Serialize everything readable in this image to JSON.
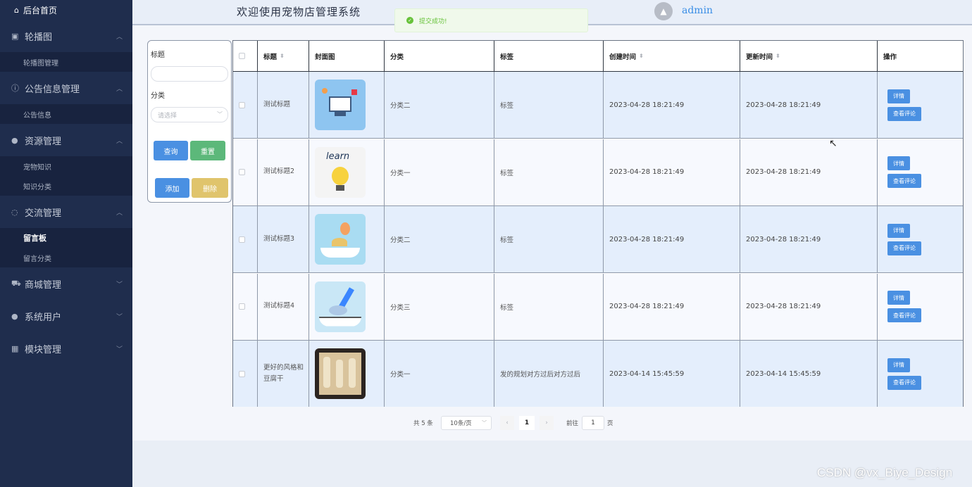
{
  "sidebar": {
    "home": "后台首页",
    "menus": [
      {
        "label": "轮播图",
        "icon": "image-icon",
        "subs": [
          "轮播图管理"
        ]
      },
      {
        "label": "公告信息管理",
        "icon": "info-icon",
        "subs": [
          "公告信息"
        ]
      },
      {
        "label": "资源管理",
        "icon": "bulb-icon",
        "subs": [
          "宠物知识",
          "知识分类"
        ]
      },
      {
        "label": "交流管理",
        "icon": "chat-icon",
        "subs": [
          "留言板",
          "留言分类"
        ]
      },
      {
        "label": "商城管理",
        "icon": "cart-icon",
        "subs": []
      },
      {
        "label": "系统用户",
        "icon": "user-icon",
        "subs": []
      },
      {
        "label": "模块管理",
        "icon": "grid-icon",
        "subs": []
      }
    ],
    "active_sub": "留言板"
  },
  "header": {
    "welcome": "欢迎使用宠物店管理系统",
    "username": "admin"
  },
  "toast": {
    "text": "提交成功!"
  },
  "filter": {
    "title_label": "标题",
    "title_value": "",
    "category_label": "分类",
    "category_placeholder": "请选择",
    "query_label": "查询",
    "reset_label": "重置",
    "add_label": "添加",
    "delete_label": "删除"
  },
  "table": {
    "headers": [
      "标题",
      "封面图",
      "分类",
      "标签",
      "创建时间",
      "更新时间",
      "操作"
    ],
    "rows": [
      {
        "title": "测试标题",
        "image": "computer-illustration",
        "category": "分类二",
        "tag": "标签",
        "created": "2023-04-28 18:21:49",
        "updated": "2023-04-28 18:21:49"
      },
      {
        "title": "测试标题2",
        "image": "learn-bulb-illustration",
        "category": "分类一",
        "tag": "标签",
        "created": "2023-04-28 18:21:49",
        "updated": "2023-04-28 18:21:49"
      },
      {
        "title": "测试标题3",
        "image": "book-balloon-illustration",
        "category": "分类二",
        "tag": "标签",
        "created": "2023-04-28 18:21:49",
        "updated": "2023-04-28 18:21:49"
      },
      {
        "title": "测试标题4",
        "image": "book-rocket-illustration",
        "category": "分类三",
        "tag": "标签",
        "created": "2023-04-28 18:21:49",
        "updated": "2023-04-28 18:21:49"
      },
      {
        "title": "更好的风格和豆腐干",
        "image": "gift-box-photo",
        "category": "分类一",
        "tag": "发的规划对方过后对方过后",
        "created": "2023-04-14 15:45:59",
        "updated": "2023-04-14 15:45:59"
      }
    ],
    "detail_label": "详情",
    "comment_label": "查看评论"
  },
  "pager": {
    "total": "共 5 条",
    "page_size": "10条/页",
    "current": "1",
    "goto_label": "前往",
    "goto_value": "1",
    "page_unit": "页"
  },
  "watermark": "CSDN @vx_Biye_Design",
  "colors": {
    "sidebar": "#1f2d4d",
    "primary": "#4a90e2",
    "success": "#5cb87a",
    "warning": "#e0c46c"
  }
}
